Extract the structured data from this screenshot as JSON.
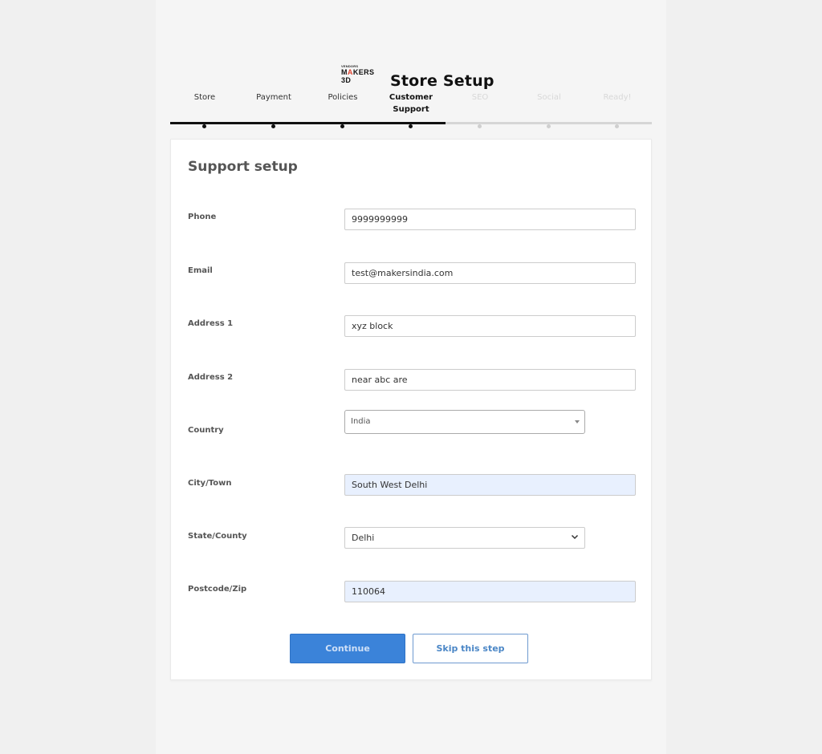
{
  "brand": {
    "top_line": "VENDORS",
    "name_prefix": "M",
    "name_accent": "A",
    "name_suffix": "KERS 3D"
  },
  "header": {
    "title": "Store Setup"
  },
  "steps": [
    {
      "label": "Store",
      "state": "done"
    },
    {
      "label": "Payment",
      "state": "done"
    },
    {
      "label": "Policies",
      "state": "done"
    },
    {
      "label": "Customer\nSupport",
      "state": "active"
    },
    {
      "label": "SEO",
      "state": "future"
    },
    {
      "label": "Social",
      "state": "future"
    },
    {
      "label": "Ready!",
      "state": "future"
    }
  ],
  "form": {
    "heading": "Support setup",
    "phone": {
      "label": "Phone",
      "value": "9999999999"
    },
    "email": {
      "label": "Email",
      "value": "test@makersindia.com"
    },
    "address1": {
      "label": "Address 1",
      "value": "xyz block"
    },
    "address2": {
      "label": "Address 2",
      "value": "near abc are"
    },
    "country": {
      "label": "Country",
      "value": "India"
    },
    "city": {
      "label": "City/Town",
      "value": "South West Delhi"
    },
    "state": {
      "label": "State/County",
      "value": "Delhi"
    },
    "postcode": {
      "label": "Postcode/Zip",
      "value": "110064"
    }
  },
  "actions": {
    "continue_label": "Continue",
    "skip_label": "Skip this step"
  },
  "colors": {
    "accent": "#3b83d9",
    "progress_done": "#111111",
    "progress_future": "#d6d6d6",
    "autofill_bg": "#e8f0fe",
    "logo_accent": "#e0422e"
  }
}
